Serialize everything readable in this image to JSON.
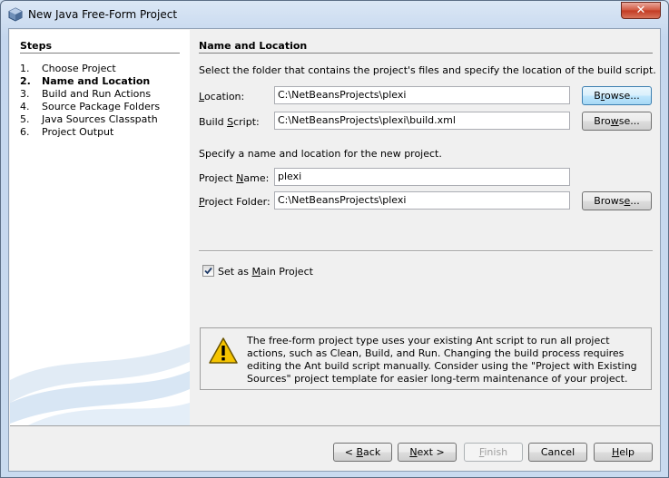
{
  "window": {
    "title": "New Java Free-Form Project",
    "close_label": "✕"
  },
  "steps": {
    "title": "Steps",
    "items": [
      {
        "num": "1.",
        "label": "Choose Project"
      },
      {
        "num": "2.",
        "label": "Name and Location"
      },
      {
        "num": "3.",
        "label": "Build and Run Actions"
      },
      {
        "num": "4.",
        "label": "Source Package Folders"
      },
      {
        "num": "5.",
        "label": "Java Sources Classpath"
      },
      {
        "num": "6.",
        "label": "Project Output"
      }
    ],
    "active_index": 1
  },
  "section": {
    "title": "Name and Location",
    "intro": "Select the folder that contains the project's files and specify the location of the build script.",
    "location_label": "Location:",
    "location_value": "C:\\NetBeansProjects\\plexi",
    "build_script_label": "Build Script:",
    "build_script_value": "C:\\NetBeansProjects\\plexi\\build.xml",
    "browse_label": "Browse...",
    "name_intro": "Specify a name and location for the new project.",
    "project_name_label": "Project Name:",
    "project_name_value": "plexi",
    "project_folder_label": "Project Folder:",
    "project_folder_value": "C:\\NetBeansProjects\\plexi",
    "main_project_label": "Set as Main Project",
    "main_project_checked": true
  },
  "warning": {
    "icon": "warning-icon",
    "text": "The free-form project type uses your existing Ant script to run all project actions, such as Clean, Build, and Run. Changing the build process requires editing the Ant build script manually. Consider using the \"Project with Existing Sources\" project template for easier long-term maintenance of your  project."
  },
  "footer": {
    "back_label": "< Back",
    "next_label": "Next >",
    "finish_label": "Finish",
    "cancel_label": "Cancel",
    "help_label": "Help"
  },
  "colors": {
    "accent": "#3c7fb1",
    "warning": "#f5c400"
  }
}
